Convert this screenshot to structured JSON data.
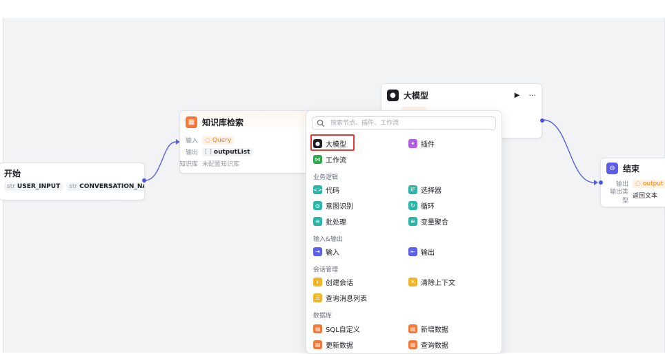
{
  "nodes": {
    "start": {
      "title": "开始",
      "params": [
        {
          "tag": "str",
          "name": "USER_INPUT"
        },
        {
          "tag": "str",
          "name": "CONVERSATION_NAME"
        }
      ]
    },
    "knowledge": {
      "title": "知识库检索",
      "input_label": "输入",
      "input_value": "Query",
      "output_label": "输出",
      "output_value": "outputList",
      "kb_label": "知识库",
      "kb_value": "未配置知识库"
    },
    "llm": {
      "title": "大模型",
      "run_icon": "▶",
      "more_icon": "···"
    },
    "end": {
      "title": "结束",
      "output_label": "输出",
      "output_value": "output",
      "type_label": "输出类型",
      "type_value": "返回文本"
    }
  },
  "panel": {
    "search_placeholder": "搜索节点、插件、工作流",
    "top_items": [
      {
        "label": "大模型",
        "icon": "llm-icon",
        "color": "#1d1f23"
      },
      {
        "label": "插件",
        "icon": "plugin-icon",
        "color": "#b35de5"
      },
      {
        "label": "工作流",
        "icon": "workflow-icon",
        "color": "#2fa84f"
      }
    ],
    "groups": [
      {
        "title": "业务逻辑",
        "items": [
          {
            "label": "代码",
            "icon": "code-icon",
            "color": "#2bb5a8"
          },
          {
            "label": "选择器",
            "icon": "if-icon",
            "color": "#2bb5a8"
          },
          {
            "label": "意图识别",
            "icon": "intent-icon",
            "color": "#2bb5a8"
          },
          {
            "label": "循环",
            "icon": "loop-icon",
            "color": "#2bb5a8"
          },
          {
            "label": "批处理",
            "icon": "batch-icon",
            "color": "#2bb5a8"
          },
          {
            "label": "变量聚合",
            "icon": "aggregate-icon",
            "color": "#2bb5a8"
          }
        ]
      },
      {
        "title": "输入&输出",
        "items": [
          {
            "label": "输入",
            "icon": "input-icon",
            "color": "#5a5ee8"
          },
          {
            "label": "输出",
            "icon": "output-icon",
            "color": "#5a5ee8"
          }
        ]
      },
      {
        "title": "会话管理",
        "items": [
          {
            "label": "创建会话",
            "icon": "create-chat-icon",
            "color": "#f0b429"
          },
          {
            "label": "清除上下文",
            "icon": "clear-context-icon",
            "color": "#f0b429"
          },
          {
            "label": "查询消息列表",
            "icon": "message-list-icon",
            "color": "#f0b429"
          }
        ]
      },
      {
        "title": "数据库",
        "items": [
          {
            "label": "SQL自定义",
            "icon": "sql-icon",
            "color": "#f2793a"
          },
          {
            "label": "新增数据",
            "icon": "insert-data-icon",
            "color": "#f2793a"
          },
          {
            "label": "更新数据",
            "icon": "update-data-icon",
            "color": "#f2793a"
          },
          {
            "label": "查询数据",
            "icon": "query-data-icon",
            "color": "#f2793a"
          }
        ]
      }
    ]
  }
}
